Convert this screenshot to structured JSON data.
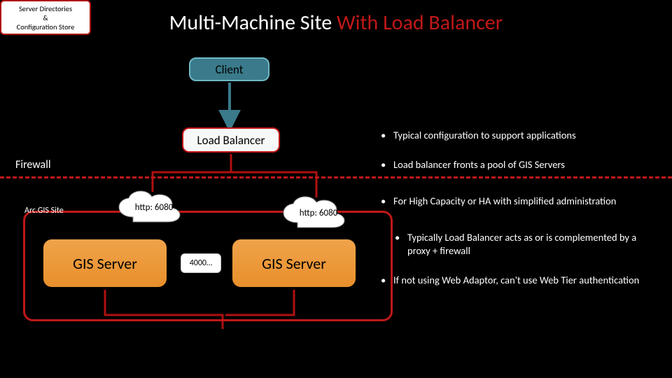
{
  "title": {
    "part1": "Multi-Machine Site ",
    "part2": "With Load Balancer"
  },
  "nodes": {
    "client": "Client",
    "load_balancer": "Load Balancer",
    "gis_server_1": "GIS Server",
    "gis_server_2": "GIS Server",
    "port_range": "4000…",
    "server_dir_line1": "Server Directories",
    "server_dir_line2": "&",
    "server_dir_line3": "Configuration Store"
  },
  "clouds": {
    "http1": "http: 6080",
    "http2": "http: 6080"
  },
  "labels": {
    "firewall": "Firewall",
    "site": "Arc.GIS Site"
  },
  "bullets": [
    "Typical configuration to support applications",
    "Load balancer fronts a pool of GIS Servers",
    "For High Capacity or HA with simplified administration",
    "Typically Load Balancer acts as or is complemented by a proxy + firewall",
    "If not using Web Adaptor, can't use Web Tier authentication"
  ],
  "colors": {
    "accent_red": "#c01818",
    "orange": "#e88f2c",
    "teal": "#3a7a8a"
  }
}
